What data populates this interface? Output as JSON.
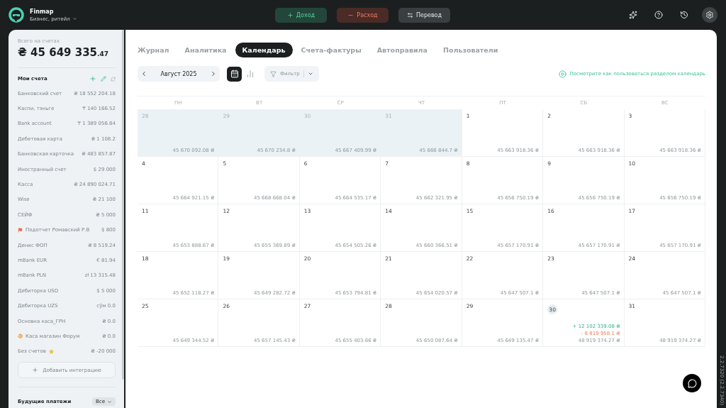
{
  "app": {
    "name": "Finmap",
    "workspace": "Бизнес, ритейл"
  },
  "actions": [
    {
      "kind": "income",
      "label": "Доход"
    },
    {
      "kind": "expense",
      "label": "Расход"
    },
    {
      "kind": "transfer",
      "label": "Перевод"
    }
  ],
  "sidebar": {
    "total_label": "Всего на счетах",
    "total": "₴ 45 649 335",
    "total_cents": ".47",
    "accounts_title": "Мои счета",
    "accounts": [
      {
        "name": "Банковский счет",
        "amount": "₴ 18 552 204",
        "cents": ".18",
        "kind": "plain"
      },
      {
        "name": "Каспи, тэньге",
        "amount": "₸ 140 166",
        "cents": ".52",
        "kind": "plain"
      },
      {
        "name": "Bank account",
        "amount": "₸ 1 389 056",
        "cents": ".84",
        "kind": "plain"
      },
      {
        "name": "Дебетовая карта",
        "amount": "₴ 1 108",
        "cents": ".2",
        "kind": "plain"
      },
      {
        "name": "Банковская карточка",
        "amount": "₴ 483 857",
        "cents": ".87",
        "kind": "plain"
      },
      {
        "name": "Иностранный счет",
        "amount": "$  29 000",
        "kind": "plain"
      },
      {
        "name": "Касса",
        "amount": "₴ 24 890 024",
        "cents": ".71",
        "kind": "plain"
      },
      {
        "name": "Wise",
        "amount": "₴ 21 100",
        "kind": "plain"
      },
      {
        "name": "СЕЙФ",
        "amount": "₴ 5 000",
        "kind": "plain"
      },
      {
        "name": "Подотчет Ромавский Р.В",
        "amount": "$  800",
        "kind": "flagged"
      },
      {
        "name": "Денис ФОП",
        "amount": "₴ 8 519",
        "cents": ".24",
        "kind": "plain"
      },
      {
        "name": "mBank EUR",
        "amount": "€ 81",
        "cents": ".94",
        "kind": "plain"
      },
      {
        "name": "mBank PLN",
        "amount": "zł 13 315",
        "cents": ".48",
        "kind": "plain"
      },
      {
        "name": "Дебиторка USD",
        "amount": "$  5 000",
        "kind": "plain"
      },
      {
        "name": "Дебиторка UZS",
        "amount": "сўм 0",
        "cents": ".0",
        "kind": "plain"
      },
      {
        "name": "Основна каса_ГРН",
        "amount": "₴ 0",
        "cents": ".0",
        "kind": "plain"
      },
      {
        "name": "Каса магазин Форум",
        "amount": "₴ 0",
        "cents": ".0",
        "kind": "pinned"
      },
      {
        "name": "Без счетов",
        "amount": "₴ -20 000",
        "kind": "starred"
      }
    ],
    "add_integration": "Добавить интеграцию",
    "future_title": "Будущие платежи",
    "future_filter": "Все"
  },
  "tabs": [
    {
      "label": "Журнал",
      "selected": false
    },
    {
      "label": "Аналитика",
      "selected": false
    },
    {
      "label": "Календарь",
      "selected": true
    },
    {
      "label": "Счета-фактуры",
      "selected": false
    },
    {
      "label": "Автоправила",
      "selected": false
    },
    {
      "label": "Пользователи",
      "selected": false
    }
  ],
  "toolbar": {
    "month": "Август 2025",
    "views": [
      {
        "kind": "calendar",
        "selected": true
      },
      {
        "kind": "chart",
        "selected": false
      }
    ],
    "filter": "Фильтр",
    "help_link": "Посмотрите как пользоваться разделом календарь"
  },
  "calendar": {
    "weekdays": [
      "ПН",
      "ВТ",
      "СР",
      "ЧТ",
      "ПТ",
      "СБ",
      "ВС"
    ],
    "days": [
      {
        "day": "28",
        "balance": "45 670 092.08 ₴",
        "outside": true
      },
      {
        "day": "29",
        "balance": "45 670 234.8 ₴",
        "outside": true
      },
      {
        "day": "30",
        "balance": "45 667 409.99 ₴",
        "outside": true
      },
      {
        "day": "31",
        "balance": "45 666 844.7 ₴",
        "outside": true
      },
      {
        "day": "1",
        "balance": "45 663 918.36 ₴",
        "outside": false
      },
      {
        "day": "2",
        "balance": "45 663 918.36 ₴",
        "outside": false
      },
      {
        "day": "3",
        "balance": "45 663 918.36 ₴",
        "outside": false
      },
      {
        "day": "4",
        "balance": "45 664 921.15 ₴",
        "outside": false
      },
      {
        "day": "5",
        "balance": "45 668 668.04 ₴",
        "outside": false
      },
      {
        "day": "6",
        "balance": "45 664 535.17 ₴",
        "outside": false
      },
      {
        "day": "7",
        "balance": "45 662 321.95 ₴",
        "outside": false
      },
      {
        "day": "8",
        "balance": "45 656 750.19 ₴",
        "outside": false
      },
      {
        "day": "9",
        "balance": "45 656 750.19 ₴",
        "outside": false
      },
      {
        "day": "10",
        "balance": "45 656 750.19 ₴",
        "outside": false
      },
      {
        "day": "11",
        "balance": "45 653 888.67 ₴",
        "outside": false
      },
      {
        "day": "12",
        "balance": "45 655 369.89 ₴",
        "outside": false
      },
      {
        "day": "13",
        "balance": "45 654 505.26 ₴",
        "outside": false
      },
      {
        "day": "14",
        "balance": "45 660 366.51 ₴",
        "outside": false
      },
      {
        "day": "15",
        "balance": "45 657 170.91 ₴",
        "outside": false
      },
      {
        "day": "16",
        "balance": "45 657 170.91 ₴",
        "outside": false
      },
      {
        "day": "17",
        "balance": "45 657 170.91 ₴",
        "outside": false
      },
      {
        "day": "18",
        "balance": "45 652 118.27 ₴",
        "outside": false
      },
      {
        "day": "19",
        "balance": "45 649 282.72 ₴",
        "outside": false
      },
      {
        "day": "20",
        "balance": "45 653 794.81 ₴",
        "outside": false
      },
      {
        "day": "21",
        "balance": "45 654 020.57 ₴",
        "outside": false
      },
      {
        "day": "22",
        "balance": "45 647 507.1 ₴",
        "outside": false
      },
      {
        "day": "23",
        "balance": "45 647 507.1 ₴",
        "outside": false
      },
      {
        "day": "24",
        "balance": "45 647 507.1 ₴",
        "outside": false
      },
      {
        "day": "25",
        "balance": "45 649 344.52 ₴",
        "outside": false
      },
      {
        "day": "26",
        "balance": "45 657 145.43 ₴",
        "outside": false
      },
      {
        "day": "27",
        "balance": "45 655 403.66 ₴",
        "outside": false
      },
      {
        "day": "28",
        "balance": "45 650 087.64 ₴",
        "outside": false
      },
      {
        "day": "29",
        "balance": "45 649 135.47 ₴",
        "outside": false
      },
      {
        "day": "30",
        "balance": "48 919 374.27 ₴",
        "outside": false,
        "today": true,
        "income": "+ 12 102 339.08 ₴",
        "expense": "- 8 819 958.1 ₴"
      },
      {
        "day": "31",
        "balance": "48 919 374.27 ₴",
        "outside": false
      }
    ]
  },
  "version": "2.2.7320 (2.2.7340)"
}
